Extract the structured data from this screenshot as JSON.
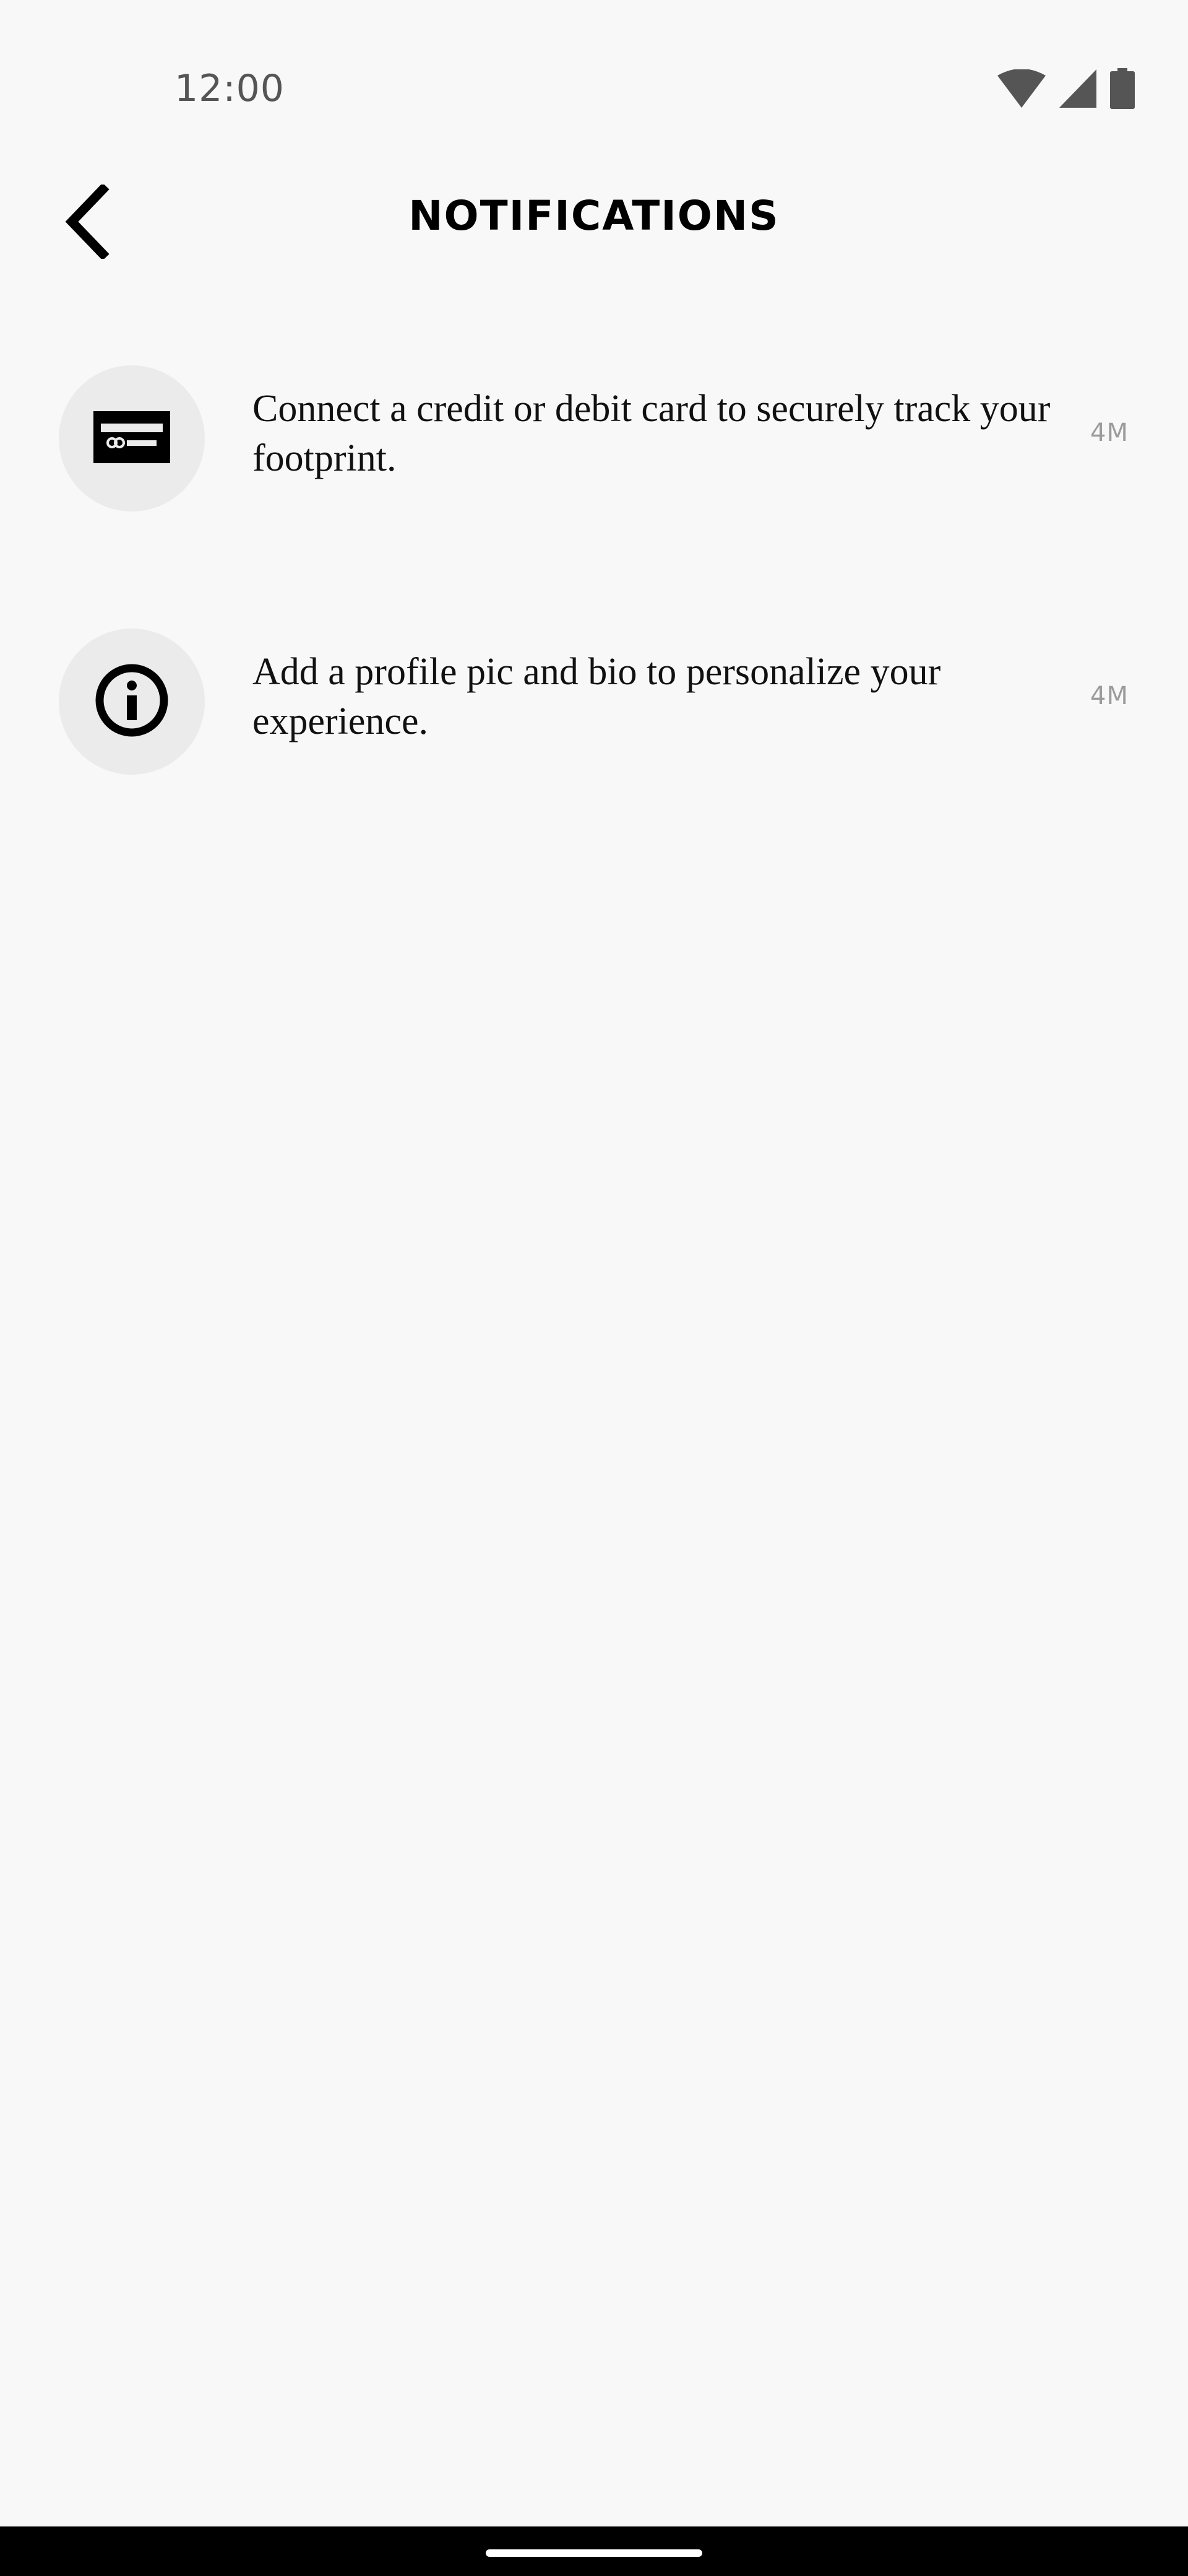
{
  "status_bar": {
    "time": "12:00",
    "icons": [
      "wifi-icon",
      "signal-icon",
      "battery-icon"
    ]
  },
  "header": {
    "title": "NOTIFICATIONS",
    "back_icon": "chevron-left-icon"
  },
  "notifications": [
    {
      "icon": "credit-card-icon",
      "text": "Connect a credit or debit card to securely track your footprint.",
      "time": "4M"
    },
    {
      "icon": "info-icon",
      "text": "Add a profile pic and bio to personalize your experience.",
      "time": "4M"
    }
  ],
  "colors": {
    "background": "#f8f8f8",
    "icon_circle": "#ebebec",
    "timestamp": "#9b9b9b",
    "nav_bar": "#000000"
  }
}
